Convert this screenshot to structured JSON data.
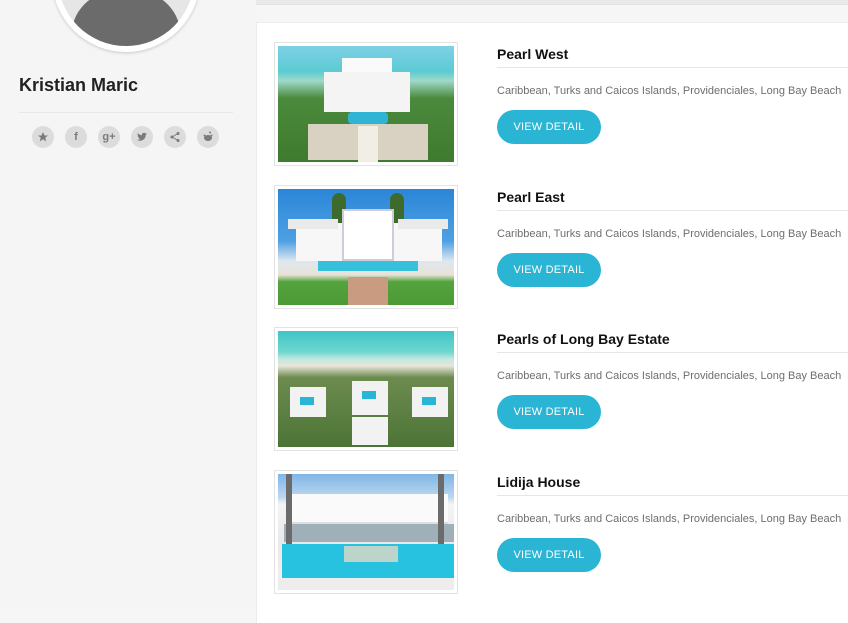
{
  "profile": {
    "name": "Kristian Maric"
  },
  "social": [
    {
      "icon": "star-icon"
    },
    {
      "icon": "facebook-icon",
      "glyph": "f"
    },
    {
      "icon": "google-plus-icon",
      "glyph": "g+"
    },
    {
      "icon": "twitter-icon"
    },
    {
      "icon": "share-icon"
    },
    {
      "icon": "reddit-icon"
    }
  ],
  "listings": [
    {
      "title": "Pearl West",
      "location": "Caribbean, Turks and Caicos Islands, Providenciales, Long Bay Beach",
      "button": "VIEW DETAIL"
    },
    {
      "title": "Pearl East",
      "location": "Caribbean, Turks and Caicos Islands, Providenciales, Long Bay Beach",
      "button": "VIEW DETAIL"
    },
    {
      "title": "Pearls of Long Bay Estate",
      "location": "Caribbean, Turks and Caicos Islands, Providenciales, Long Bay Beach",
      "button": "VIEW DETAIL"
    },
    {
      "title": "Lidija House",
      "location": "Caribbean, Turks and Caicos Islands, Providenciales, Long Bay Beach",
      "button": "VIEW DETAIL"
    }
  ],
  "colors": {
    "accent": "#2bb5d4",
    "sidebar_bg": "#f5f5f5",
    "icon_bg": "#dcdcdc"
  }
}
